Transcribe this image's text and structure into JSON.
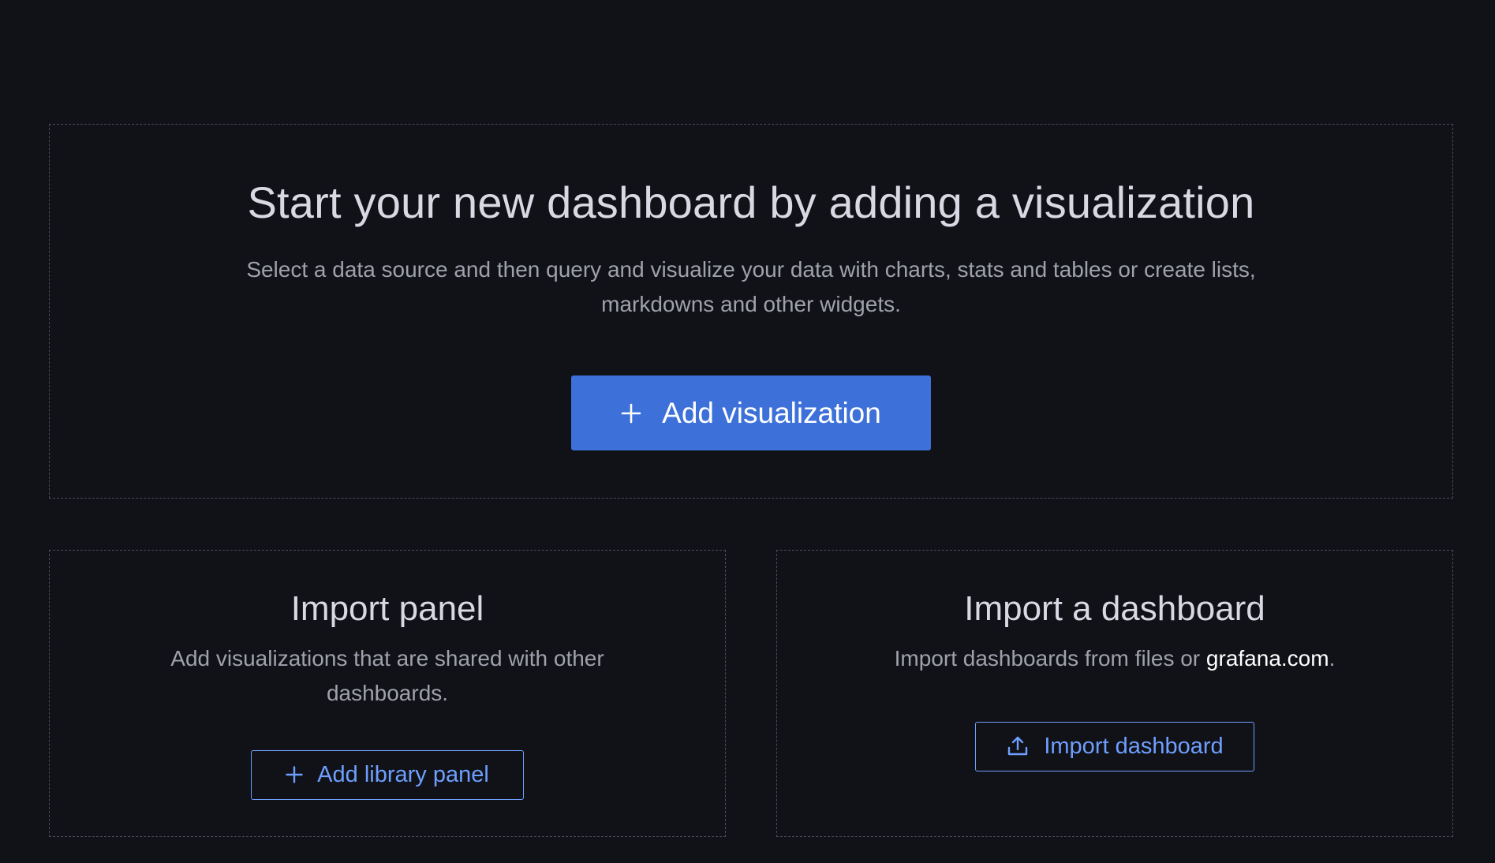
{
  "main": {
    "title": "Start your new dashboard by adding a visualization",
    "description": "Select a data source and then query and visualize your data with charts, stats and tables or create lists, markdowns and other widgets.",
    "add_visualization": {
      "label": "Add visualization",
      "icon": "plus-icon"
    }
  },
  "import_panel": {
    "title": "Import panel",
    "description": "Add visualizations that are shared with other dashboards.",
    "button": {
      "label": "Add library panel",
      "icon": "plus-icon"
    }
  },
  "import_dashboard": {
    "title": "Import a dashboard",
    "description_prefix": "Import dashboards from files or ",
    "link_text": "grafana.com",
    "description_suffix": ".",
    "button": {
      "label": "Import dashboard",
      "icon": "upload-icon"
    }
  },
  "colors": {
    "background": "#111217",
    "primary": "#3d71d9",
    "link": "#6e9fff",
    "border": "#4a4d57"
  }
}
